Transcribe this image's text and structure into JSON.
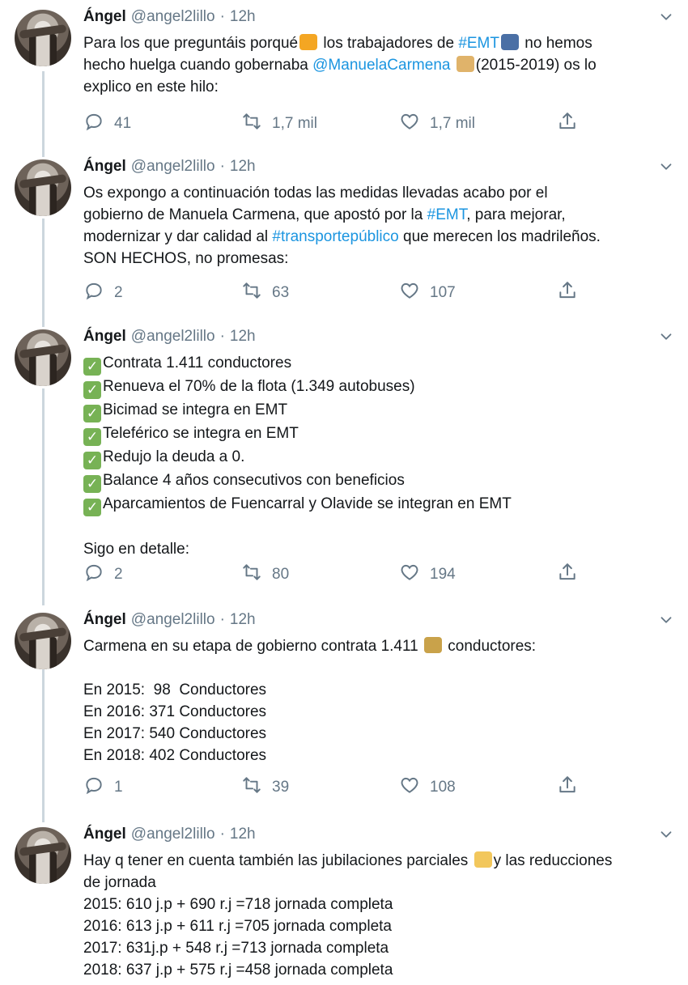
{
  "tweets": [
    {
      "name": "Ángel",
      "handle": "@angel2lillo",
      "time": "12h",
      "lines": [
        [
          {
            "t": "Para los que preguntáis porqué"
          },
          {
            "emoji": "person-shrugging",
            "color": "#f4a623"
          },
          {
            "t": " los trabajadores de "
          },
          {
            "link": "#EMT"
          },
          {
            "emoji": "bus",
            "color": "#4a6fa5"
          },
          {
            "t": " no hemos"
          }
        ],
        [
          {
            "t": "hecho huelga cuando gobernaba "
          },
          {
            "link": "@ManuelaCarmena"
          },
          {
            "t": " "
          },
          {
            "emoji": "older-woman",
            "color": "#e0b36a"
          },
          {
            "t": "(2015-2019) os lo"
          }
        ],
        [
          {
            "t": "explico en este hilo:"
          }
        ]
      ],
      "replies": "41",
      "retweets": "1,7 mil",
      "likes": "1,7 mil"
    },
    {
      "name": "Ángel",
      "handle": "@angel2lillo",
      "time": "12h",
      "lines": [
        [
          {
            "t": "Os expongo a continuación todas las medidas llevadas acabo por el"
          }
        ],
        [
          {
            "t": "gobierno de Manuela Carmena, que apostó por la "
          },
          {
            "link": "#EMT"
          },
          {
            "t": ", para mejorar,"
          }
        ],
        [
          {
            "t": "modernizar y dar calidad al "
          },
          {
            "link": "#transportepúblico"
          },
          {
            "t": " que merecen los madrileños."
          }
        ],
        [
          {
            "t": "SON HECHOS, no promesas:"
          }
        ]
      ],
      "replies": "2",
      "retweets": "63",
      "likes": "107"
    },
    {
      "name": "Ángel",
      "handle": "@angel2lillo",
      "time": "12h",
      "lines": [
        [
          {
            "check": true
          },
          {
            "t": "Contrata 1.411 conductores"
          }
        ],
        [
          {
            "check": true
          },
          {
            "t": "Renueva el 70% de la flota (1.349 autobuses)"
          }
        ],
        [
          {
            "check": true
          },
          {
            "t": "Bicimad se integra en EMT"
          }
        ],
        [
          {
            "check": true
          },
          {
            "t": "Teleférico se integra en EMT"
          }
        ],
        [
          {
            "check": true
          },
          {
            "t": "Redujo la deuda a 0."
          }
        ],
        [
          {
            "check": true
          },
          {
            "t": "Balance 4 años consecutivos con beneficios"
          }
        ],
        [
          {
            "check": true
          },
          {
            "t": "Aparcamientos de Fuencarral y Olavide se integran en EMT"
          }
        ],
        [],
        [
          {
            "t": "Sigo en detalle:"
          }
        ]
      ],
      "replies": "2",
      "retweets": "80",
      "likes": "194"
    },
    {
      "name": "Ángel",
      "handle": "@angel2lillo",
      "time": "12h",
      "lines": [
        [
          {
            "t": "Carmena en su etapa de gobierno contrata 1.411 "
          },
          {
            "emoji": "police-officer",
            "color": "#c9a24a"
          },
          {
            "t": " conductores:"
          }
        ],
        [],
        [
          {
            "t": "En 2015:  98  Conductores"
          }
        ],
        [
          {
            "t": "En 2016: 371 Conductores"
          }
        ],
        [
          {
            "t": "En 2017: 540 Conductores"
          }
        ],
        [
          {
            "t": "En 2018: 402 Conductores"
          }
        ]
      ],
      "replies": "1",
      "retweets": "39",
      "likes": "108"
    },
    {
      "name": "Ángel",
      "handle": "@angel2lillo",
      "time": "12h",
      "lines": [
        [
          {
            "t": "Hay q tener en cuenta también las jubilaciones parciales "
          },
          {
            "emoji": "older-man",
            "color": "#f2c75c"
          },
          {
            "t": "y las reducciones"
          }
        ],
        [
          {
            "t": "de jornada"
          }
        ],
        [
          {
            "t": "2015: 610 j.p + 690 r.j =718 jornada completa"
          }
        ],
        [
          {
            "t": "2016: 613 j.p + 611 r.j =705 jornada completa"
          }
        ],
        [
          {
            "t": "2017: 631j.p + 548 r.j =713 jornada completa"
          }
        ],
        [
          {
            "t": "2018: 637 j.p + 575 r.j =458 jornada completa"
          }
        ]
      ]
    }
  ]
}
